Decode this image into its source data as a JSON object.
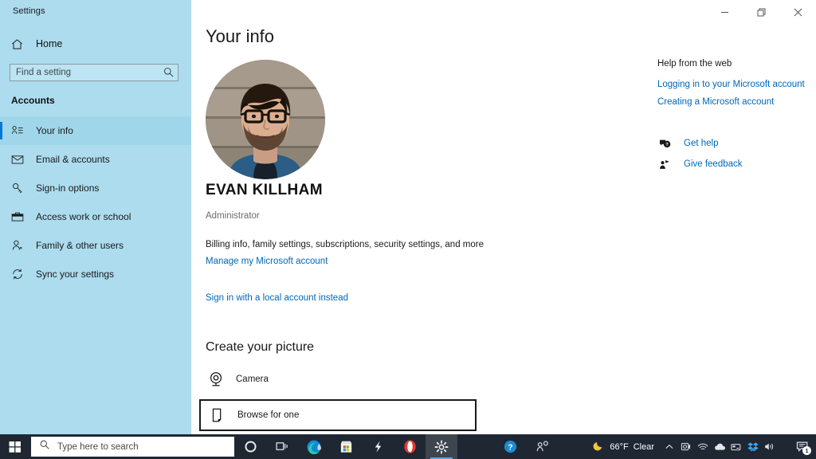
{
  "window": {
    "app_title": "Settings",
    "controls": {
      "minimize": "minimize-icon",
      "restore": "restore-icon",
      "close": "close-icon"
    }
  },
  "sidebar": {
    "home_label": "Home",
    "home_icon": "home-icon",
    "search": {
      "placeholder": "Find a setting",
      "value": "",
      "icon": "search-icon"
    },
    "section_title": "Accounts",
    "items": [
      {
        "label": "Your info",
        "icon": "user-info-icon",
        "selected": true
      },
      {
        "label": "Email & accounts",
        "icon": "mail-icon",
        "selected": false
      },
      {
        "label": "Sign-in options",
        "icon": "key-icon",
        "selected": false
      },
      {
        "label": "Access work or school",
        "icon": "briefcase-icon",
        "selected": false
      },
      {
        "label": "Family & other users",
        "icon": "people-icon",
        "selected": false
      },
      {
        "label": "Sync your settings",
        "icon": "sync-icon",
        "selected": false
      }
    ]
  },
  "main": {
    "page_title": "Your info",
    "avatar_alt": "user-profile-photo",
    "user_name": "EVAN KILLHAM",
    "user_role": "Administrator",
    "billing_text": "Billing info, family settings, subscriptions, security settings, and more",
    "manage_account_link": "Manage my Microsoft account",
    "local_account_link": "Sign in with a local account instead",
    "create_picture_title": "Create your picture",
    "picture_options": [
      {
        "label": "Camera",
        "icon": "webcam-icon",
        "focused": false
      },
      {
        "label": "Browse for one",
        "icon": "document-icon",
        "focused": true
      }
    ]
  },
  "help": {
    "heading": "Help from the web",
    "links": [
      "Logging in to your Microsoft account",
      "Creating a Microsoft account"
    ],
    "actions": [
      {
        "label": "Get help",
        "icon": "help-bubble-icon"
      },
      {
        "label": "Give feedback",
        "icon": "feedback-icon"
      }
    ]
  },
  "taskbar": {
    "start_icon": "windows-start-icon",
    "search": {
      "placeholder": "Type here to search",
      "icon": "search-icon"
    },
    "cortana_icon": "cortana-icon",
    "apps": [
      {
        "name": "task-view-icon",
        "active": false
      },
      {
        "name": "microsoft-edge-icon",
        "active": false
      },
      {
        "name": "microsoft-store-icon",
        "active": false
      },
      {
        "name": "lightning-bolt-icon",
        "active": false
      },
      {
        "name": "opera-browser-icon",
        "active": false
      },
      {
        "name": "settings-gear-icon",
        "active": true
      },
      {
        "name": "help-circle-icon",
        "active": false
      },
      {
        "name": "people-pin-icon",
        "active": false
      }
    ],
    "weather": {
      "icon": "moon-icon",
      "temperature": "66°F",
      "condition": "Clear"
    },
    "tray_icons": [
      "chevron-up-icon",
      "webcam-tray-icon",
      "wifi-icon",
      "onedrive-cloud-icon",
      "card-reader-icon",
      "dropbox-icon",
      "volume-icon"
    ],
    "notification": {
      "icon": "action-center-icon",
      "count": "1"
    }
  },
  "colors": {
    "sidebar_bg": "#ACDCEE",
    "accent": "#0078D4",
    "link": "#0067B8",
    "taskbar_bg": "#1F2733",
    "content_bg": "#FFFFFF"
  }
}
